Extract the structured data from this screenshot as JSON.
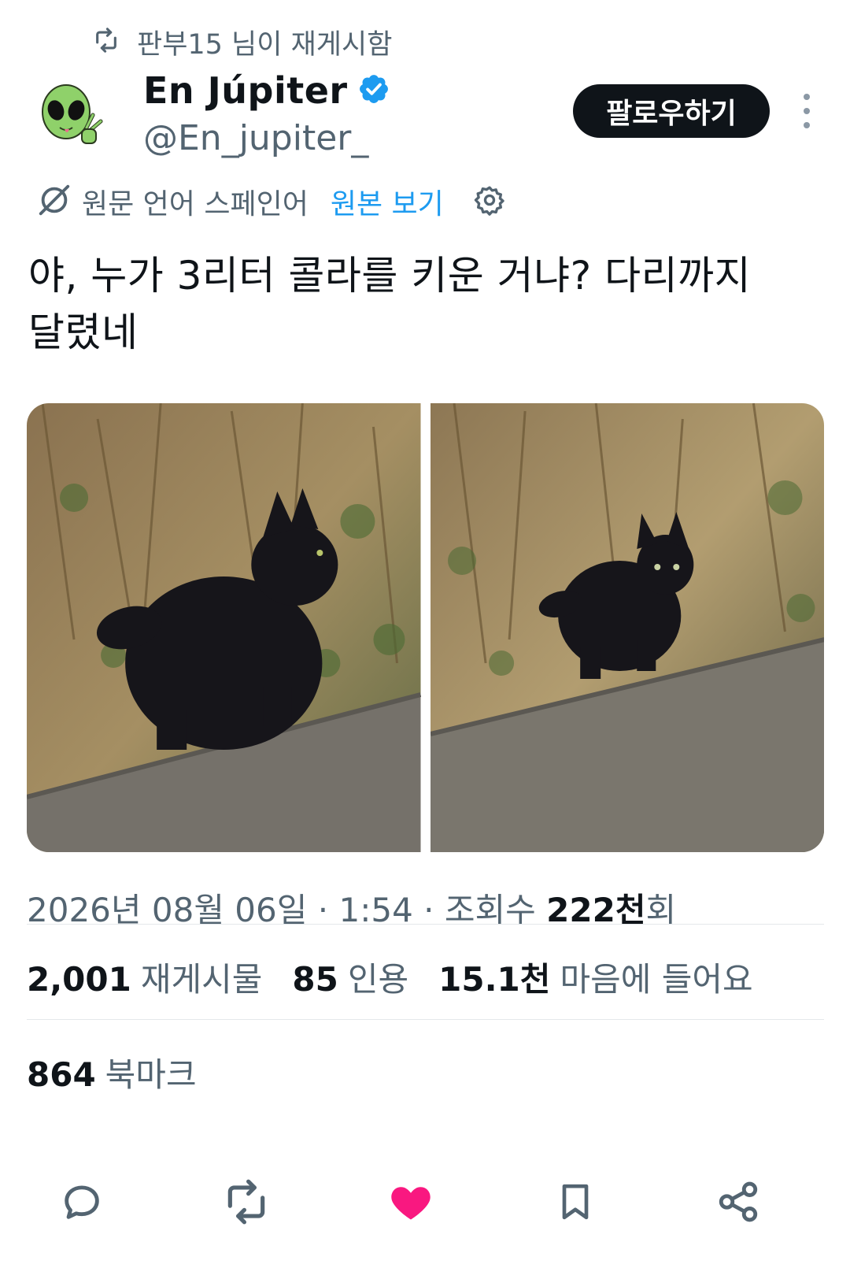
{
  "retweet": {
    "text": "판부15 님이 재게시함"
  },
  "author": {
    "name": "En Júpiter",
    "handle": "@En_jupiter_",
    "verified": true
  },
  "follow_label": "팔로우하기",
  "translation": {
    "source_text": "원문 언어 스페인어",
    "show_original": "원본 보기"
  },
  "tweet": {
    "text": "야, 누가 3리터 콜라를 키운 거냐? 다리까지\n달렸네"
  },
  "media": [
    {
      "description": "black cat standing on a concrete wall"
    },
    {
      "description": "black cat on a concrete wall looking at camera"
    }
  ],
  "meta": {
    "date": "2026년 08월 06일",
    "time": "1:54",
    "views_prefix": "조회수",
    "views_value": "222천",
    "views_suffix": "회",
    "separator": "·"
  },
  "stats": {
    "reposts": {
      "value": "2,001",
      "label": "재게시물"
    },
    "quotes": {
      "value": "85",
      "label": "인용"
    },
    "likes": {
      "value": "15.1천",
      "label": "마음에 들어요"
    },
    "bookmarks": {
      "value": "864",
      "label": "북마크"
    }
  },
  "colors": {
    "accent": "#1d9bf0",
    "like": "#f91880",
    "text": "#0f1419",
    "muted": "#536471"
  },
  "actions": [
    "reply-icon",
    "repost-icon",
    "like-icon",
    "bookmark-icon",
    "share-icon"
  ]
}
